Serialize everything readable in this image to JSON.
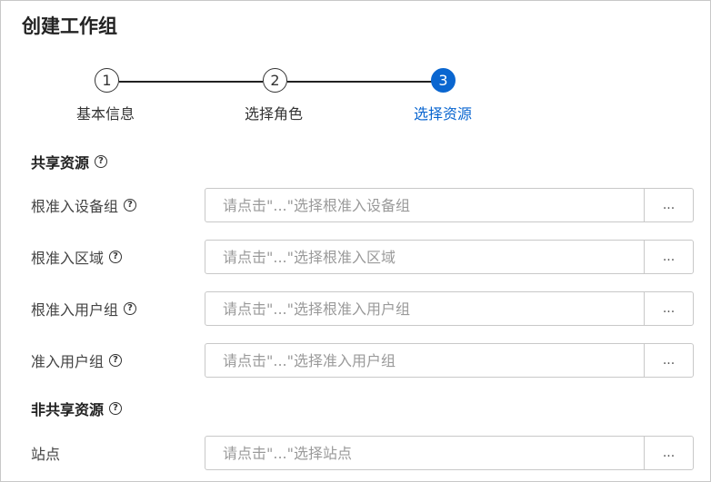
{
  "page": {
    "title": "创建工作组"
  },
  "steps": [
    {
      "number": "1",
      "label": "基本信息"
    },
    {
      "number": "2",
      "label": "选择角色"
    },
    {
      "number": "3",
      "label": "选择资源"
    }
  ],
  "active_step": 3,
  "accent_color": "#0a66d0",
  "icons": {
    "help": "help-circle-icon",
    "help_glyph": "?"
  },
  "shared_section": {
    "title": "共享资源",
    "fields": [
      {
        "label": "根准入设备组",
        "placeholder": "请点击\"...\"选择根准入设备组",
        "value": "",
        "button": "..."
      },
      {
        "label": "根准入区域",
        "placeholder": "请点击\"...\"选择根准入区域",
        "value": "",
        "button": "..."
      },
      {
        "label": "根准入用户组",
        "placeholder": "请点击\"...\"选择根准入用户组",
        "value": "",
        "button": "..."
      },
      {
        "label": "准入用户组",
        "placeholder": "请点击\"...\"选择准入用户组",
        "value": "",
        "button": "..."
      }
    ]
  },
  "nonshared_section": {
    "title": "非共享资源",
    "fields": [
      {
        "label": "站点",
        "placeholder": "请点击\"...\"选择站点",
        "value": "",
        "button": "..."
      }
    ]
  }
}
